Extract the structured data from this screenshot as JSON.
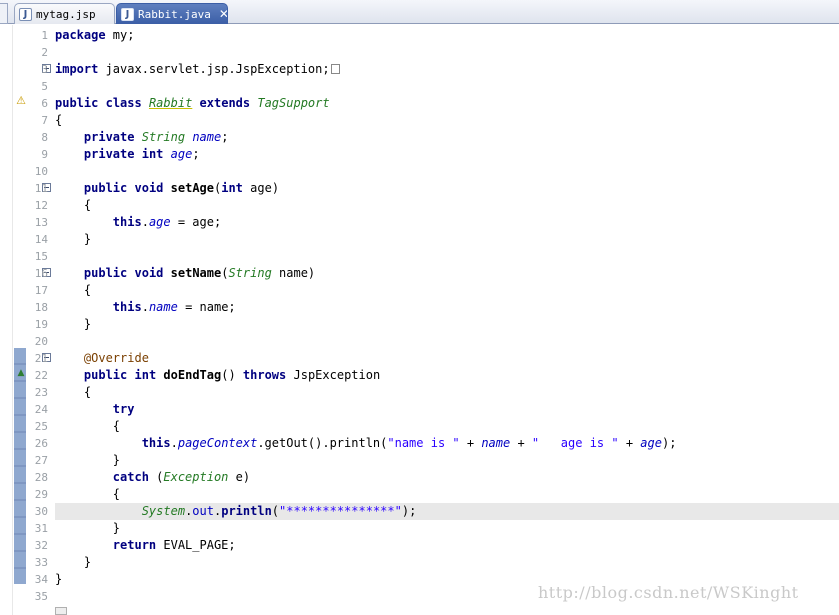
{
  "tabs": [
    {
      "label": "mytag.jsp",
      "icon": "jsp-file-icon",
      "active": false
    },
    {
      "label": "Rabbit.java",
      "icon": "java-file-icon",
      "active": true,
      "close": "✕"
    }
  ],
  "line_numbers": [
    "1",
    "2",
    "3",
    "5",
    "6",
    "7",
    "8",
    "9",
    "10",
    "11",
    "12",
    "13",
    "14",
    "15",
    "16",
    "17",
    "18",
    "19",
    "20",
    "21",
    "22",
    "23",
    "24",
    "25",
    "26",
    "27",
    "28",
    "29",
    "30",
    "31",
    "32",
    "33",
    "34",
    "35"
  ],
  "code": {
    "l1_kw": "package",
    "l1_rest": " my;",
    "l3_kw": "import",
    "l3_rest": " javax.servlet.jsp.JspException;",
    "l6_kw1": "public",
    "l6_kw2": "class",
    "l6_name": "Rabbit",
    "l6_kw3": "extends",
    "l6_super": "TagSupport",
    "l7": "{",
    "l8_kw": "private",
    "l8_type": "String",
    "l8_field": "name",
    "l8_end": ";",
    "l9_kw": "private",
    "l9_type": "int",
    "l9_field": "age",
    "l9_end": ";",
    "l11_kw1": "public",
    "l11_kw2": "void",
    "l11_name": "setAge",
    "l11_open": "(",
    "l11_type": "int",
    "l11_param": " age)",
    "l12": "{",
    "l13_kw": "this",
    "l13_dot": ".",
    "l13_field": "age",
    "l13_rest": " = age;",
    "l14": "}",
    "l16_kw1": "public",
    "l16_kw2": "void",
    "l16_name": "setName",
    "l16_open": "(",
    "l16_type": "String",
    "l16_param": " name)",
    "l17": "{",
    "l18_kw": "this",
    "l18_dot": ".",
    "l18_field": "name",
    "l18_rest": " = name;",
    "l19": "}",
    "l21": "@Override",
    "l22_kw1": "public",
    "l22_kw2": "int",
    "l22_name": "doEndTag",
    "l22_mid": "() ",
    "l22_kw3": "throws",
    "l22_rest": " JspException",
    "l23": "{",
    "l24_kw": "try",
    "l25": "{",
    "l26_kw": "this",
    "l26_dot": ".",
    "l26_field": "pageContext",
    "l26_mid": ".getOut().println(",
    "l26_str1": "\"name is \"",
    "l26_plus1": " + ",
    "l26_var1": "name",
    "l26_plus2": " + ",
    "l26_str2": "\"   age is \"",
    "l26_plus3": " + ",
    "l26_var2": "age",
    "l26_end": ");",
    "l27": "}",
    "l28_kw": "catch",
    "l28_open": " (",
    "l28_type": "Exception",
    "l28_rest": " e)",
    "l29": "{",
    "l30_sys": "System",
    "l30_dot": ".",
    "l30_out": "out",
    "l30_dot2": ".",
    "l30_method": "println",
    "l30_open": "(",
    "l30_str": "\"***************\"",
    "l30_end": ");",
    "l31": "}",
    "l32_kw": "return",
    "l32_rest": " EVAL_PAGE;",
    "l33": "}",
    "l34": "}"
  },
  "watermark": "http://blog.csdn.net/WSKinght",
  "colors": {
    "keyword": "#000080",
    "type": "#247a24",
    "string": "#2a00ff",
    "tab_active": "#3b5ea6"
  }
}
